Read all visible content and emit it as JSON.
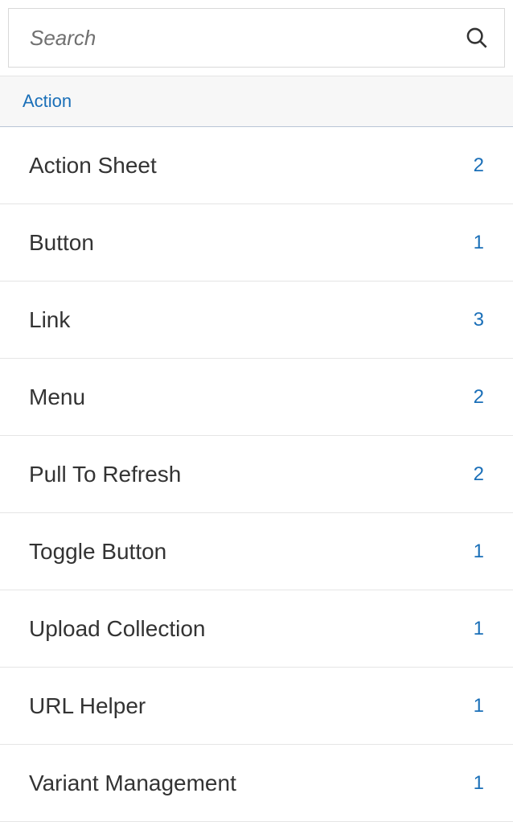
{
  "search": {
    "placeholder": "Search"
  },
  "section": {
    "header": "Action"
  },
  "items": [
    {
      "label": "Action Sheet",
      "count": "2"
    },
    {
      "label": "Button",
      "count": "1"
    },
    {
      "label": "Link",
      "count": "3"
    },
    {
      "label": "Menu",
      "count": "2"
    },
    {
      "label": "Pull To Refresh",
      "count": "2"
    },
    {
      "label": "Toggle Button",
      "count": "1"
    },
    {
      "label": "Upload Collection",
      "count": "1"
    },
    {
      "label": "URL Helper",
      "count": "1"
    },
    {
      "label": "Variant Management",
      "count": "1"
    }
  ]
}
